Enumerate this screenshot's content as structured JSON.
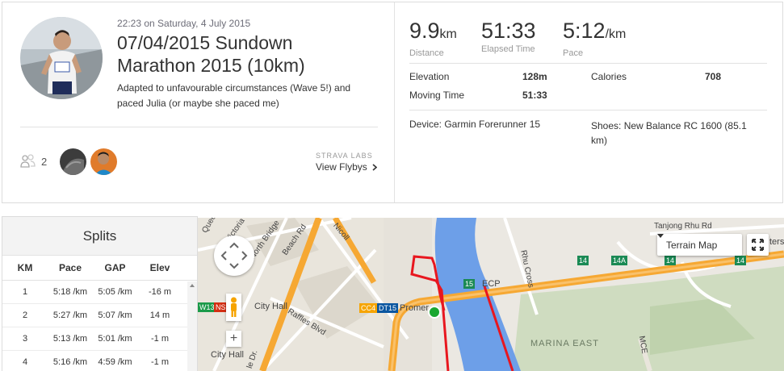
{
  "activity": {
    "datetime": "22:23 on Saturday, 4 July 2015",
    "title_line1": "07/04/2015 Sundown",
    "title_line2": "Marathon 2015 (10km)",
    "description": "Adapted to unfavourable circumstances (Wave 5!) and paced Julia (or maybe she paced me)",
    "kudos_count": "2"
  },
  "flyby": {
    "lab_label": "STRAVA LABS",
    "link_label": "View Flybys"
  },
  "stats": {
    "distance": {
      "value": "9.9",
      "unit": "km",
      "label": "Distance"
    },
    "elapsed": {
      "value": "51:33",
      "label": "Elapsed Time"
    },
    "pace": {
      "value": "5:12",
      "unit": "/km",
      "label": "Pace"
    },
    "elevation_label": "Elevation",
    "elevation_value": "128m",
    "calories_label": "Calories",
    "calories_value": "708",
    "moving_label": "Moving Time",
    "moving_value": "51:33",
    "device": "Device: Garmin Forerunner 15",
    "shoes": "Shoes: New Balance RC 1600 (85.1 km)"
  },
  "splits": {
    "title": "Splits",
    "columns": [
      "KM",
      "Pace",
      "GAP",
      "Elev"
    ],
    "rows": [
      {
        "km": "1",
        "pace": "5:18 /km",
        "gap": "5:05 /km",
        "elev": "-16 m"
      },
      {
        "km": "2",
        "pace": "5:27 /km",
        "gap": "5:07 /km",
        "elev": "14 m"
      },
      {
        "km": "3",
        "pace": "5:13 /km",
        "gap": "5:01 /km",
        "elev": "-1 m"
      },
      {
        "km": "4",
        "pace": "5:16 /km",
        "gap": "4:59 /km",
        "elev": "-1 m"
      }
    ]
  },
  "map": {
    "map_type": "Terrain Map",
    "labels": {
      "city_hall": "City Hall",
      "city_hall_2": "City Hall",
      "raffles": "Raffles Blvd",
      "beach": "Beach Rd",
      "nicoll": "Nicoll",
      "victoria": "Victoria",
      "north_bridge": "North Bridge",
      "queen": "Quee",
      "promenade": "Promer",
      "rhu_cross": "Rhu Cross",
      "tanjong": "Tanjong Rhu Rd",
      "marina_east": "MARINA EAST",
      "mce": "MCE",
      "ecp": "ECP",
      "e_drive": "le Dr.",
      "shelters": "ters"
    },
    "badges": {
      "ew13": "W13",
      "ns": "NS",
      "cc4": "CC4",
      "dt15": "DT15",
      "e15": "15",
      "e14a": "14",
      "e14b": "14A",
      "e14c": "14",
      "e14d": "14"
    },
    "colors": {
      "route": "#e8171f",
      "water": "#6d9fe8",
      "expressway": "#f6a833",
      "park": "#cfdcc0",
      "start_marker": "#1aa730"
    }
  }
}
